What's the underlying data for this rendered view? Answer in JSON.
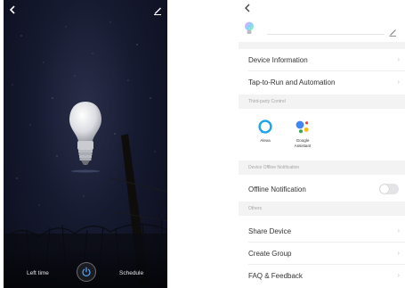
{
  "bulb_screen": {
    "back_icon": "chevron-left-icon",
    "edit_icon": "pencil-icon",
    "left_time_label": "Left time",
    "schedule_label": "Schedule",
    "power_icon": "power-icon"
  },
  "settings_screen": {
    "back_icon": "chevron-left-icon",
    "device_name": "",
    "rows": {
      "device_information": "Device Information",
      "tap_to_run": "Tap-to-Run and Automation",
      "offline_notification": "Offline Notification",
      "share_device": "Share Device",
      "create_group": "Create Group",
      "faq_feedback": "FAQ & Feedback"
    },
    "sections": {
      "third_party": "Third-party Control",
      "offline_notification": "Device Offline Notification",
      "others": "Others"
    },
    "third_party": {
      "alexa": "Alexa",
      "google_line1": "Google",
      "google_line2": "Assistant"
    },
    "offline_notification_enabled": false
  },
  "colors": {
    "night_sky": "#161a30",
    "section_bg": "#f3f3f4",
    "alexa_blue": "#1ea5e6",
    "google_blue": "#4285f4",
    "google_red": "#ea4335",
    "google_yellow": "#fbbc05",
    "google_green": "#34a853"
  }
}
